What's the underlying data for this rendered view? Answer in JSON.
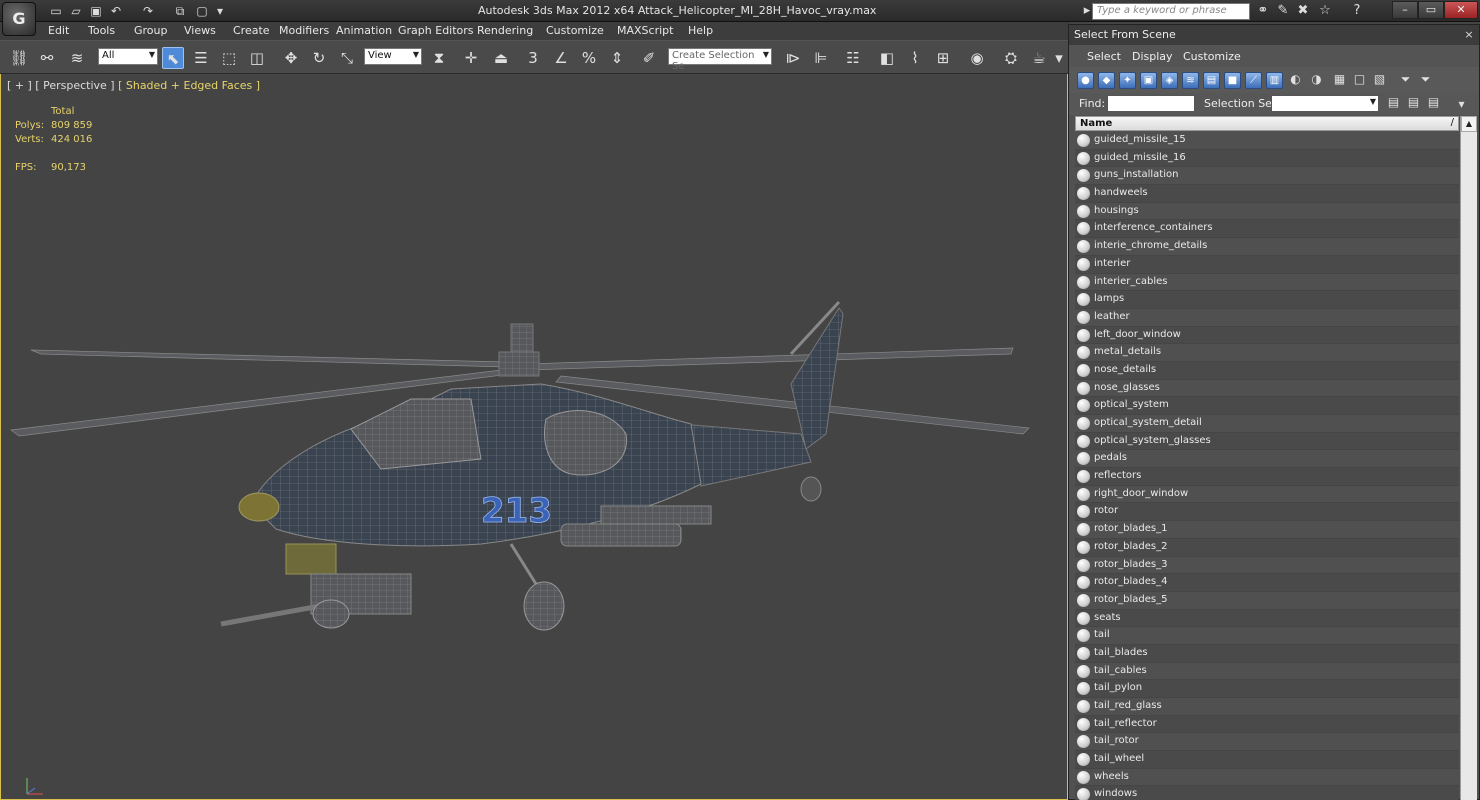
{
  "app": {
    "logo": "G",
    "title": "Autodesk 3ds Max  2012 x64     Attack_Helicopter_MI_28H_Havoc_vray.max",
    "search_placeholder": "Type a keyword or phrase"
  },
  "menu": [
    "Edit",
    "Tools",
    "Group",
    "Views",
    "Create",
    "Modifiers",
    "Animation",
    "Graph Editors",
    "Rendering",
    "Customize",
    "MAXScript",
    "Help"
  ],
  "toolbar": {
    "filter_value": "All",
    "ref_coord_value": "View",
    "selection_set_placeholder": "Create Selection Se"
  },
  "viewport": {
    "label_prefix": "[ + ] [ Perspective ] ",
    "label_shading": "[ Shaded + Edged Faces ]",
    "stats": {
      "total_label": "Total",
      "polys_label": "Polys:",
      "polys_value": "809 859",
      "verts_label": "Verts:",
      "verts_value": "424 016",
      "fps_label": "FPS:",
      "fps_value": "90,173"
    },
    "fuselage_number": "213"
  },
  "panel": {
    "title": "Select From Scene",
    "close": "×",
    "menus": [
      "Select",
      "Display",
      "Customize"
    ],
    "find_label": "Find:",
    "selection_set_label": "Selection Set:",
    "column_name": "Name",
    "sort_indicator": "/",
    "items": [
      "guided_missile_15",
      "guided_missile_16",
      "guns_installation",
      "handweels",
      "housings",
      "interference_containers",
      "interie_chrome_details",
      "interier",
      "interier_cables",
      "lamps",
      "leather",
      "left_door_window",
      "metal_details",
      "nose_details",
      "nose_glasses",
      "optical_system",
      "optical_system_detail",
      "optical_system_glasses",
      "pedals",
      "reflectors",
      "right_door_window",
      "rotor",
      "rotor_blades_1",
      "rotor_blades_2",
      "rotor_blades_3",
      "rotor_blades_4",
      "rotor_blades_5",
      "seats",
      "tail",
      "tail_blades",
      "tail_cables",
      "tail_pylon",
      "tail_red_glass",
      "tail_reflector",
      "tail_rotor",
      "tail_wheel",
      "wheels",
      "windows"
    ]
  }
}
